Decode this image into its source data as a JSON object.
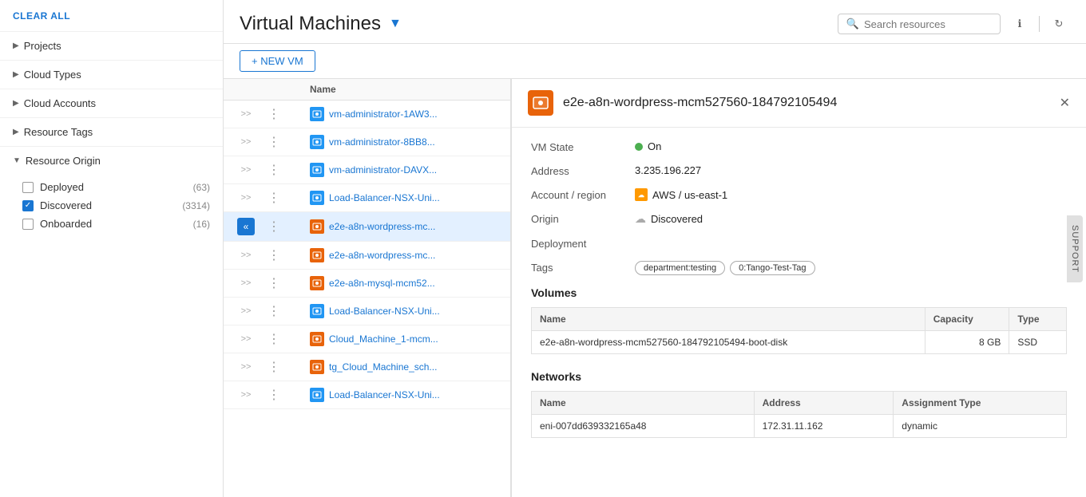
{
  "sidebar": {
    "clear_all_label": "CLEAR ALL",
    "sections": [
      {
        "id": "projects",
        "label": "Projects",
        "expanded": false,
        "items": []
      },
      {
        "id": "cloud-types",
        "label": "Cloud Types",
        "expanded": false,
        "items": []
      },
      {
        "id": "cloud-accounts",
        "label": "Cloud Accounts",
        "expanded": false,
        "items": []
      },
      {
        "id": "resource-tags",
        "label": "Resource Tags",
        "expanded": false,
        "items": []
      },
      {
        "id": "resource-origin",
        "label": "Resource Origin",
        "expanded": true,
        "items": [
          {
            "label": "Deployed",
            "count": "63",
            "checked": false
          },
          {
            "label": "Discovered",
            "count": "3314",
            "checked": true
          },
          {
            "label": "Onboarded",
            "count": "16",
            "checked": false
          }
        ]
      }
    ]
  },
  "header": {
    "title": "Virtual Machines",
    "search_placeholder": "Search resources",
    "new_vm_label": "+ NEW VM",
    "filter_icon": "▼"
  },
  "vm_list": {
    "column_name": "Name",
    "rows": [
      {
        "name": "vm-administrator-1AW3...",
        "icon_type": "blue",
        "selected": false
      },
      {
        "name": "vm-administrator-8BB8...",
        "icon_type": "blue",
        "selected": false
      },
      {
        "name": "vm-administrator-DAVX...",
        "icon_type": "blue",
        "selected": false
      },
      {
        "name": "Load-Balancer-NSX-Uni...",
        "icon_type": "blue",
        "selected": false
      },
      {
        "name": "e2e-a8n-wordpress-mc...",
        "icon_type": "orange",
        "selected": true
      },
      {
        "name": "e2e-a8n-wordpress-mc...",
        "icon_type": "orange",
        "selected": false
      },
      {
        "name": "e2e-a8n-mysql-mcm52...",
        "icon_type": "orange",
        "selected": false
      },
      {
        "name": "Load-Balancer-NSX-Uni...",
        "icon_type": "blue",
        "selected": false
      },
      {
        "name": "Cloud_Machine_1-mcm...",
        "icon_type": "orange",
        "selected": false
      },
      {
        "name": "tg_Cloud_Machine_sch...",
        "icon_type": "orange",
        "selected": false
      },
      {
        "name": "Load-Balancer-NSX-Uni...",
        "icon_type": "blue",
        "selected": false
      }
    ]
  },
  "detail": {
    "title": "e2e-a8n-wordpress-mcm527560-184792105494",
    "icon_type": "orange",
    "vm_state_label": "VM State",
    "vm_state_value": "On",
    "address_label": "Address",
    "address_value": "3.235.196.227",
    "account_region_label": "Account / region",
    "account_region_value": "AWS / us-east-1",
    "origin_label": "Origin",
    "origin_value": "Discovered",
    "deployment_label": "Deployment",
    "deployment_value": "",
    "tags_label": "Tags",
    "tags": [
      "department:testing",
      "0:Tango-Test-Tag"
    ],
    "volumes_title": "Volumes",
    "volumes_columns": [
      "Name",
      "Capacity",
      "Type"
    ],
    "volumes_rows": [
      {
        "name": "e2e-a8n-wordpress-mcm527560-184792105494-boot-disk",
        "capacity": "8 GB",
        "type": "SSD"
      }
    ],
    "networks_title": "Networks",
    "networks_columns": [
      "Name",
      "Address",
      "Assignment Type"
    ],
    "networks_rows": [
      {
        "name": "eni-007dd639332165a48",
        "address": "172.31.11.162",
        "assignment_type": "dynamic"
      }
    ]
  },
  "support_label": "SUPPORT"
}
